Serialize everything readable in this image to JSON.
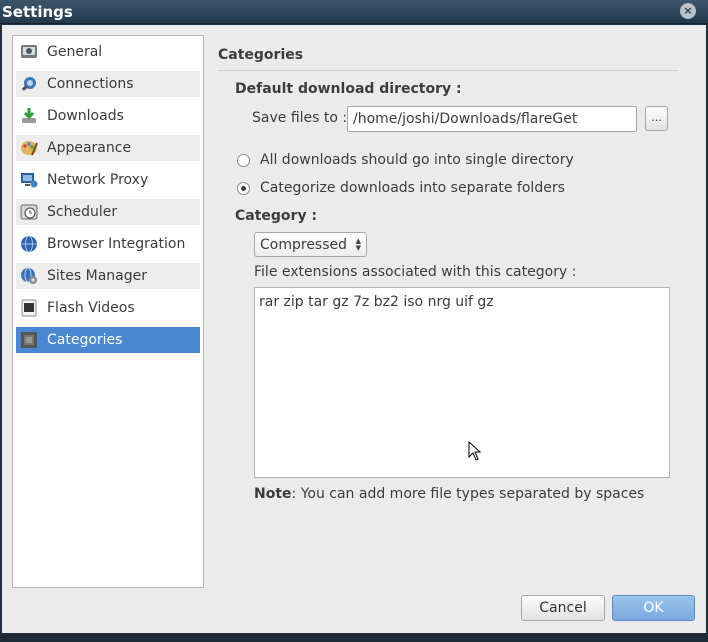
{
  "window": {
    "title": "Settings",
    "close_glyph": "×"
  },
  "sidebar": {
    "items": [
      {
        "label": "General",
        "icon": "general-icon"
      },
      {
        "label": "Connections",
        "icon": "connections-icon"
      },
      {
        "label": "Downloads",
        "icon": "downloads-icon"
      },
      {
        "label": "Appearance",
        "icon": "appearance-icon"
      },
      {
        "label": "Network Proxy",
        "icon": "network-proxy-icon"
      },
      {
        "label": "Scheduler",
        "icon": "scheduler-icon"
      },
      {
        "label": "Browser Integration",
        "icon": "browser-integration-icon"
      },
      {
        "label": "Sites Manager",
        "icon": "sites-manager-icon"
      },
      {
        "label": "Flash Videos",
        "icon": "flash-videos-icon"
      },
      {
        "label": "Categories",
        "icon": "categories-icon",
        "selected": true
      }
    ],
    "selected_color": "#4a89d2"
  },
  "categories": {
    "section_title": "Categories",
    "default_dir_heading": "Default download directory :",
    "save_files_label": "Save files to :",
    "save_path": "/home/joshi/Downloads/flareGet",
    "browse_label": "...",
    "radio_single": "All downloads should go into single directory",
    "radio_categorize": "Categorize downloads into separate folders",
    "radio_selected": "categorize",
    "category_heading": "Category :",
    "category_selected": "Compressed",
    "extensions_label": "File extensions associated with this category :",
    "extensions_value": "rar zip tar gz 7z bz2 iso nrg uif gz",
    "note_bold": "Note",
    "note_text": ": You can add more file types separated by spaces"
  },
  "buttons": {
    "cancel_label": "Cancel",
    "ok_label": "OK",
    "ok_color": "#78a9de"
  }
}
